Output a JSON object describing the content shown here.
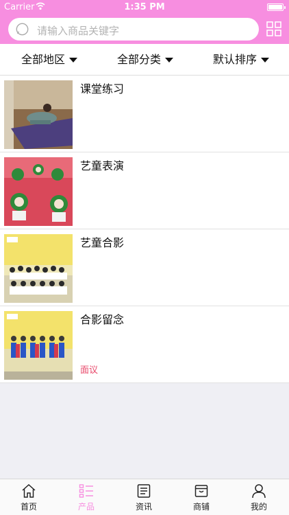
{
  "status_bar": {
    "carrier": "Carrier",
    "time": "1:35 PM"
  },
  "search": {
    "placeholder": "请输入商品关键字"
  },
  "filters": [
    {
      "label": "全部地区"
    },
    {
      "label": "全部分类"
    },
    {
      "label": "默认排序"
    }
  ],
  "products": [
    {
      "title": "课堂练习",
      "price": ""
    },
    {
      "title": "艺童表演",
      "price": ""
    },
    {
      "title": "艺童合影",
      "price": ""
    },
    {
      "title": "合影留念",
      "price": "面议"
    }
  ],
  "tabbar": {
    "items": [
      {
        "label": "首页",
        "icon": "home-icon",
        "active": false
      },
      {
        "label": "产品",
        "icon": "product-list-icon",
        "active": true
      },
      {
        "label": "资讯",
        "icon": "news-icon",
        "active": false
      },
      {
        "label": "商铺",
        "icon": "shop-icon",
        "active": false
      },
      {
        "label": "我的",
        "icon": "user-icon",
        "active": false
      }
    ]
  },
  "colors": {
    "accent": "#f78ee0",
    "price": "#e8486a"
  }
}
